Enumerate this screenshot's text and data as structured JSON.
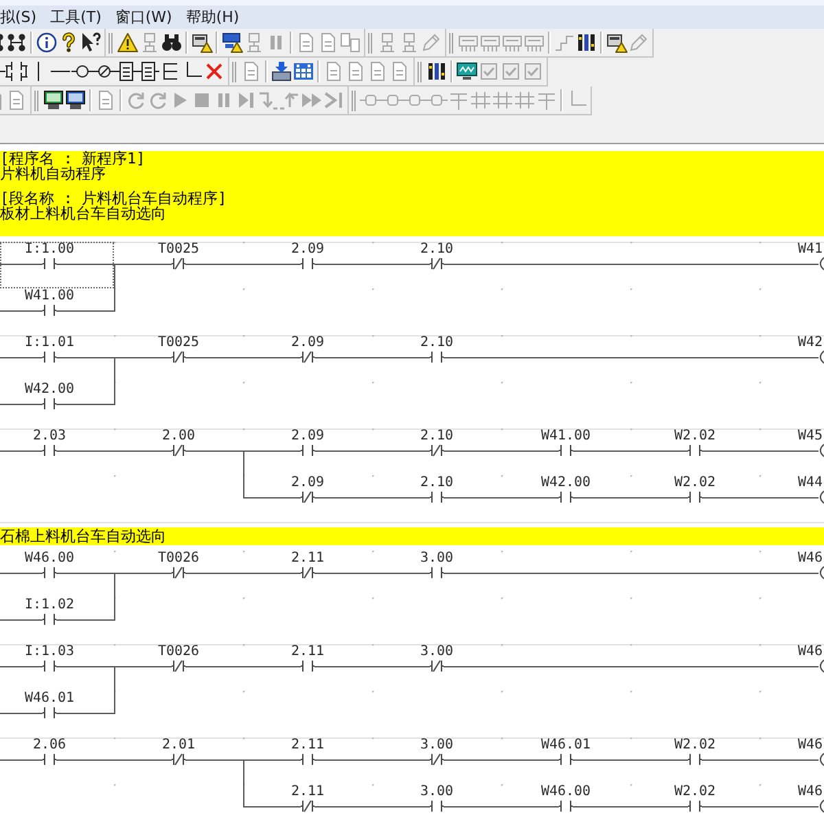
{
  "menu_bar": {
    "items": [
      {
        "label": "拟(S)"
      },
      {
        "label": "工具(T)"
      },
      {
        "label": "窗口(W)"
      },
      {
        "label": "帮助(H)"
      }
    ]
  },
  "toolbar_rows": [
    {
      "toolbars": [
        {
          "groups": [
            [
              {
                "kind": "network",
                "disabled": false
              },
              {
                "kind": "network",
                "disabled": false
              }
            ],
            [
              {
                "kind": "info",
                "disabled": false
              },
              {
                "kind": "help",
                "disabled": false
              },
              {
                "kind": "whatsthis",
                "disabled": false
              }
            ]
          ]
        },
        {
          "groups": [
            [
              {
                "kind": "warning",
                "disabled": false
              },
              {
                "kind": "device",
                "disabled": true
              },
              {
                "kind": "binoculars",
                "disabled": false
              }
            ],
            [
              {
                "kind": "devicewarning",
                "disabled": false
              }
            ],
            [
              {
                "kind": "transfer",
                "disabled": false
              },
              {
                "kind": "device",
                "disabled": true
              },
              {
                "kind": "pause",
                "disabled": true
              }
            ],
            [
              {
                "kind": "document",
                "disabled": true
              },
              {
                "kind": "document",
                "disabled": true
              },
              {
                "kind": "compare",
                "disabled": true
              }
            ]
          ]
        },
        {
          "groups": [
            [
              {
                "kind": "device",
                "disabled": true
              },
              {
                "kind": "device",
                "disabled": true
              },
              {
                "kind": "pencil",
                "disabled": true
              }
            ]
          ]
        },
        {
          "groups": [
            [
              {
                "kind": "module",
                "disabled": true
              },
              {
                "kind": "module",
                "disabled": true
              },
              {
                "kind": "module",
                "disabled": true
              },
              {
                "kind": "module",
                "disabled": true
              }
            ],
            [
              {
                "kind": "step",
                "disabled": true
              },
              {
                "kind": "bars",
                "disabled": false
              }
            ],
            [
              {
                "kind": "devicewarning",
                "disabled": false
              },
              {
                "kind": "pencil",
                "disabled": true
              }
            ]
          ]
        }
      ]
    },
    {
      "toolbars": [
        {
          "groups": [
            [
              {
                "kind": "contact",
                "disabled": false
              },
              {
                "kind": "parallel",
                "disabled": false
              },
              {
                "kind": "vline",
                "disabled": false
              },
              {
                "kind": "hline",
                "disabled": false
              },
              {
                "kind": "coil",
                "disabled": false
              },
              {
                "kind": "negcoil",
                "disabled": false
              },
              {
                "kind": "instruction",
                "disabled": false
              },
              {
                "kind": "instruction",
                "disabled": false
              },
              {
                "kind": "branch",
                "disabled": false
              },
              {
                "kind": "corner",
                "disabled": false
              },
              {
                "kind": "delete",
                "disabled": false
              }
            ]
          ]
        },
        {
          "groups": [
            [
              {
                "kind": "document",
                "disabled": true
              }
            ],
            [
              {
                "kind": "download",
                "disabled": false
              },
              {
                "kind": "calendar",
                "disabled": false
              }
            ],
            [
              {
                "kind": "document",
                "disabled": true
              },
              {
                "kind": "document",
                "disabled": true
              },
              {
                "kind": "document",
                "disabled": true
              },
              {
                "kind": "document",
                "disabled": true
              }
            ]
          ]
        },
        {
          "groups": [
            [
              {
                "kind": "bars",
                "disabled": false
              }
            ],
            [
              {
                "kind": "scope",
                "disabled": false
              },
              {
                "kind": "check",
                "disabled": true
              },
              {
                "kind": "check",
                "disabled": true
              },
              {
                "kind": "check",
                "disabled": true
              }
            ]
          ]
        }
      ]
    },
    {
      "toolbars": [
        {
          "groups": [
            [
              {
                "kind": "document",
                "disabled": true
              },
              {
                "kind": "document",
                "disabled": true
              }
            ]
          ]
        },
        {
          "groups": [
            [
              {
                "kind": "monitor",
                "disabled": false
              },
              {
                "kind": "display",
                "disabled": false
              }
            ],
            [
              {
                "kind": "document",
                "disabled": true
              }
            ],
            [
              {
                "kind": "refresh",
                "disabled": true
              },
              {
                "kind": "refresh",
                "disabled": true
              },
              {
                "kind": "play",
                "disabled": true
              },
              {
                "kind": "stop",
                "disabled": true
              },
              {
                "kind": "pause",
                "disabled": true
              },
              {
                "kind": "stepforward",
                "disabled": true
              },
              {
                "kind": "stepinto",
                "disabled": true
              },
              {
                "kind": "stepout",
                "disabled": true
              },
              {
                "kind": "fastforward",
                "disabled": true
              },
              {
                "kind": "skipend",
                "disabled": true
              }
            ]
          ]
        },
        {
          "groups": [
            [
              {
                "kind": "node",
                "disabled": true
              },
              {
                "kind": "node",
                "disabled": true
              },
              {
                "kind": "node",
                "disabled": true
              },
              {
                "kind": "node",
                "disabled": true
              },
              {
                "kind": "tee",
                "disabled": true
              },
              {
                "kind": "grid",
                "disabled": true
              },
              {
                "kind": "grid",
                "disabled": true
              },
              {
                "kind": "grid",
                "disabled": true
              },
              {
                "kind": "tee",
                "disabled": true
              }
            ],
            [
              {
                "kind": "corner",
                "disabled": true
              }
            ]
          ]
        }
      ]
    }
  ],
  "program_comment": {
    "blocks": [
      {
        "title": "[程序名 : 新程序1]",
        "text": "片料机自动程序"
      },
      {
        "title": "[段名称 : 片料机台车自动程序]",
        "text": "板材上料机台车自动选向"
      }
    ]
  },
  "rungs": [
    {
      "rows": [
        {
          "cells": [
            {
              "kind": "no",
              "operand": "I:1.00",
              "selected": true
            },
            {
              "kind": "nc",
              "operand": "T0025",
              "selected": false
            },
            {
              "kind": "no",
              "operand": "2.09",
              "selected": false
            },
            {
              "kind": "nc",
              "operand": "2.10",
              "selected": false
            },
            {
              "kind": "wire",
              "selected": false
            },
            {
              "kind": "wire",
              "selected": false
            },
            {
              "kind": "coil",
              "operand": "W41",
              "selected": false
            }
          ]
        },
        {
          "cells": [
            {
              "kind": "no",
              "operand": "W41.00",
              "selected": false
            }
          ]
        }
      ]
    },
    {
      "rows": [
        {
          "cells": [
            {
              "kind": "no",
              "operand": "I:1.01",
              "selected": false
            },
            {
              "kind": "nc",
              "operand": "T0025",
              "selected": false
            },
            {
              "kind": "nc",
              "operand": "2.09",
              "selected": false
            },
            {
              "kind": "no",
              "operand": "2.10",
              "selected": false
            },
            {
              "kind": "wire",
              "selected": false
            },
            {
              "kind": "wire",
              "selected": false
            },
            {
              "kind": "coil",
              "operand": "W42",
              "selected": false
            }
          ]
        },
        {
          "cells": [
            {
              "kind": "no",
              "operand": "W42.00",
              "selected": false
            }
          ]
        }
      ]
    },
    {
      "rows": [
        {
          "cells": [
            {
              "kind": "no",
              "operand": "2.03",
              "selected": false
            },
            {
              "kind": "nc",
              "operand": "2.00",
              "selected": false
            },
            {
              "kind": "no",
              "operand": "2.09",
              "selected": false
            },
            {
              "kind": "nc",
              "operand": "2.10",
              "selected": false
            },
            {
              "kind": "no",
              "operand": "W41.00",
              "selected": false
            },
            {
              "kind": "no",
              "operand": "W2.02",
              "selected": false
            },
            {
              "kind": "coil",
              "operand": "W45",
              "selected": false
            }
          ]
        },
        {
          "cells": [
            {
              "kind": "blank",
              "selected": false
            },
            {
              "kind": "blank",
              "selected": false
            },
            {
              "kind": "nc",
              "operand": "2.09",
              "selected": false
            },
            {
              "kind": "no",
              "operand": "2.10",
              "selected": false
            },
            {
              "kind": "no",
              "operand": "W42.00",
              "selected": false
            },
            {
              "kind": "no",
              "operand": "W2.02",
              "selected": false
            },
            {
              "kind": "coil",
              "operand": "W44",
              "selected": false
            }
          ]
        }
      ]
    },
    {
      "comment": "石棉上料机台车自动选向",
      "rows": [
        {
          "cells": [
            {
              "kind": "no",
              "operand": "W46.00",
              "selected": false
            },
            {
              "kind": "nc",
              "operand": "T0026",
              "selected": false
            },
            {
              "kind": "nc",
              "operand": "2.11",
              "selected": false
            },
            {
              "kind": "no",
              "operand": "3.00",
              "selected": false
            },
            {
              "kind": "wire",
              "selected": false
            },
            {
              "kind": "wire",
              "selected": false
            },
            {
              "kind": "coil",
              "operand": "W46",
              "selected": false
            }
          ]
        },
        {
          "cells": [
            {
              "kind": "no",
              "operand": "I:1.02",
              "selected": false
            }
          ]
        }
      ]
    },
    {
      "rows": [
        {
          "cells": [
            {
              "kind": "no",
              "operand": "I:1.03",
              "selected": false
            },
            {
              "kind": "nc",
              "operand": "T0026",
              "selected": false
            },
            {
              "kind": "no",
              "operand": "2.11",
              "selected": false
            },
            {
              "kind": "nc",
              "operand": "3.00",
              "selected": false
            },
            {
              "kind": "wire",
              "selected": false
            },
            {
              "kind": "wire",
              "selected": false
            },
            {
              "kind": "coil",
              "operand": "W46",
              "selected": false
            }
          ]
        },
        {
          "cells": [
            {
              "kind": "no",
              "operand": "W46.01",
              "selected": false
            }
          ]
        }
      ]
    },
    {
      "rows": [
        {
          "cells": [
            {
              "kind": "no",
              "operand": "2.06",
              "selected": false
            },
            {
              "kind": "nc",
              "operand": "2.01",
              "selected": false
            },
            {
              "kind": "no",
              "operand": "2.11",
              "selected": false
            },
            {
              "kind": "nc",
              "operand": "3.00",
              "selected": false
            },
            {
              "kind": "no",
              "operand": "W46.01",
              "selected": false
            },
            {
              "kind": "no",
              "operand": "W2.02",
              "selected": false
            },
            {
              "kind": "coil",
              "operand": "W46",
              "selected": false
            }
          ]
        },
        {
          "cells": [
            {
              "kind": "blank",
              "selected": false
            },
            {
              "kind": "blank",
              "selected": false
            },
            {
              "kind": "nc",
              "operand": "2.11",
              "selected": false
            },
            {
              "kind": "no",
              "operand": "3.00",
              "selected": false
            },
            {
              "kind": "no",
              "operand": "W46.00",
              "selected": false
            },
            {
              "kind": "no",
              "operand": "W2.02",
              "selected": false
            },
            {
              "kind": "coil",
              "operand": "W46",
              "selected": false
            }
          ]
        }
      ]
    }
  ]
}
